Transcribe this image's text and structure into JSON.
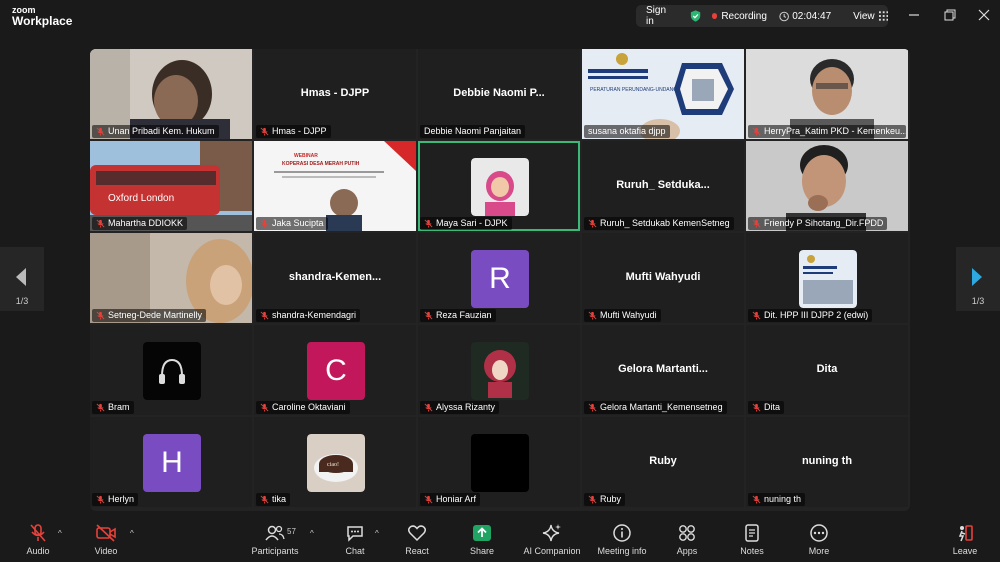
{
  "app": {
    "logo_line1": "zoom",
    "logo_line2": "Workplace"
  },
  "status": {
    "sign_in": "Sign in",
    "recording": "Recording",
    "elapsed": "02:04:47",
    "view": "View"
  },
  "pager": {
    "left_page": "1/3",
    "right_page": "1/3"
  },
  "tiles": [
    {
      "label": "Unan Pribadi Kem. Hukum",
      "center": ""
    },
    {
      "label": "Hmas - DJPP",
      "center": "Hmas - DJPP"
    },
    {
      "label": "Debbie Naomi Panjaitan",
      "center": "Debbie  Naomi  P..."
    },
    {
      "label": "susana oktafia djpp",
      "center": ""
    },
    {
      "label": "HerryPra_Katim PKD - Kemenkeu...",
      "center": ""
    },
    {
      "label": "Mahartha DDIOKK",
      "center": ""
    },
    {
      "label": "Jaka Sucipta",
      "center": ""
    },
    {
      "label": "Maya Sari - DJPK",
      "center": ""
    },
    {
      "label": "Ruruh_ Setdukab KemenSetneg",
      "center": "Ruruh_  Setduka..."
    },
    {
      "label": "Friendy P Sihotang_Dir.FPDD",
      "center": ""
    },
    {
      "label": "Setneg-Dede Martinelly",
      "center": ""
    },
    {
      "label": "shandra-Kemendagri",
      "center": "shandra-Kemen..."
    },
    {
      "label": "Reza Fauzian",
      "center": "",
      "avatar": "R"
    },
    {
      "label": "Mufti Wahyudi",
      "center": "Mufti Wahyudi"
    },
    {
      "label": "Dit. HPP III DJPP 2 (edwi)",
      "center": ""
    },
    {
      "label": "Bram",
      "center": ""
    },
    {
      "label": "Caroline Oktaviani",
      "center": "",
      "avatar": "C"
    },
    {
      "label": "Alyssa Rizanty",
      "center": ""
    },
    {
      "label": "Gelora Martanti_Kemensetneg",
      "center": "Gelora  Martanti..."
    },
    {
      "label": "Dita",
      "center": "Dita"
    },
    {
      "label": "Herlyn",
      "center": "",
      "avatar": "H"
    },
    {
      "label": "tika",
      "center": ""
    },
    {
      "label": "Honiar Arf",
      "center": ""
    },
    {
      "label": "Ruby",
      "center": "Ruby"
    },
    {
      "label": "nuning th",
      "center": "nuning th"
    }
  ],
  "thumbs": {
    "bus_text": "Oxford  London",
    "webinar_title": "WEBINAR",
    "webinar_sub": "KOPERASI DESA MERAH PUTIH",
    "slide_title": "PERATURAN PERUNDANG-UNDANGAN",
    "cake_text": "ciao!"
  },
  "toolbar": {
    "audio": "Audio",
    "video": "Video",
    "participants": "Participants",
    "participants_count": "57",
    "chat": "Chat",
    "react": "React",
    "share": "Share",
    "ai": "AI Companion",
    "meeting_info": "Meeting info",
    "apps": "Apps",
    "notes": "Notes",
    "more": "More",
    "leave": "Leave"
  },
  "colors": {
    "accent_green": "#3cb878",
    "muted_red": "#e8413a",
    "avatar_purple": "#7a4cc2",
    "avatar_pink": "#c2185b",
    "pager_arrow": "#2ea8e0"
  }
}
